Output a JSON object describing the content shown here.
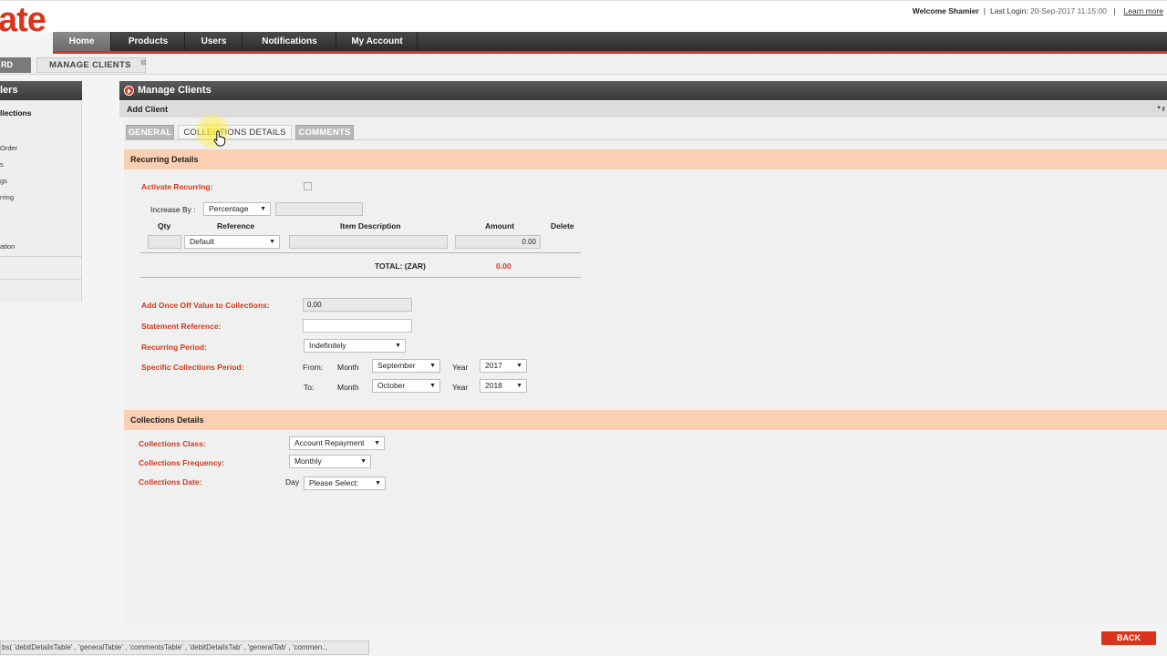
{
  "header": {
    "logo_text": "ate",
    "welcome": "Welcome Shamier",
    "last_login_label": "Last Login:",
    "last_login_value": "20-Sep-2017 11:15:00",
    "learn_more": "Learn more"
  },
  "nav": {
    "items": [
      "Home",
      "Products",
      "Users",
      "Notifications",
      "My Account"
    ]
  },
  "breadcrumbs": {
    "first": "RD",
    "current": "MANAGE CLIENTS",
    "close_glyph": "⊠"
  },
  "sidebar": {
    "title": "lers",
    "items": [
      "llections",
      "Order",
      "s",
      "gs",
      "rring",
      "ation"
    ]
  },
  "main": {
    "title": "Manage Clients",
    "subtitle": "Add Client",
    "required_mark": "* r",
    "tabs": [
      "GENERAL",
      "COLLECTIONS DETAILS",
      "COMMENTS"
    ],
    "active_tab": "COLLECTIONS DETAILS"
  },
  "recurring": {
    "section_title": "Recurring Details",
    "activate_label": "Activate Recurring:",
    "activate_checked": false,
    "increase_by_label": "Increase By :",
    "increase_by_value": "Percentage",
    "increase_by_amount": "",
    "columns": {
      "qty": "Qty",
      "reference": "Reference",
      "description": "Item Description",
      "amount": "Amount",
      "delete": "Delete"
    },
    "row": {
      "qty": "",
      "reference": "Default",
      "description": "",
      "amount": "0.00"
    },
    "total_label": "TOTAL: (ZAR)",
    "total_value": "0.00",
    "once_off_label": "Add Once Off Value to Collections:",
    "once_off_value": "0.00",
    "statement_ref_label": "Statement Reference:",
    "statement_ref_value": "",
    "period_label": "Recurring Period:",
    "period_value": "Indefinitely",
    "specific_label": "Specific Collections Period:",
    "from_label": "From:",
    "to_label": "To:",
    "month_label": "Month",
    "year_label": "Year",
    "from_month": "September",
    "from_year": "2017",
    "to_month": "October",
    "to_year": "2018"
  },
  "collections": {
    "section_title": "Collections Details",
    "class_label": "Collections Class:",
    "class_value": "Account Repayment",
    "frequency_label": "Collections Frequency:",
    "frequency_value": "Monthly",
    "date_label": "Collections Date:",
    "day_label": "Day",
    "date_value": "Please Select:"
  },
  "footer": {
    "status_text": "bs( 'debitDetailsTable' , 'generalTable' , 'commentsTable' , 'debitDetailsTab' , 'generalTab' , 'commen...",
    "back_label": "BACK"
  },
  "colors": {
    "accent": "#d9351c",
    "band": "#fbd0b2",
    "nav": "#333333"
  }
}
